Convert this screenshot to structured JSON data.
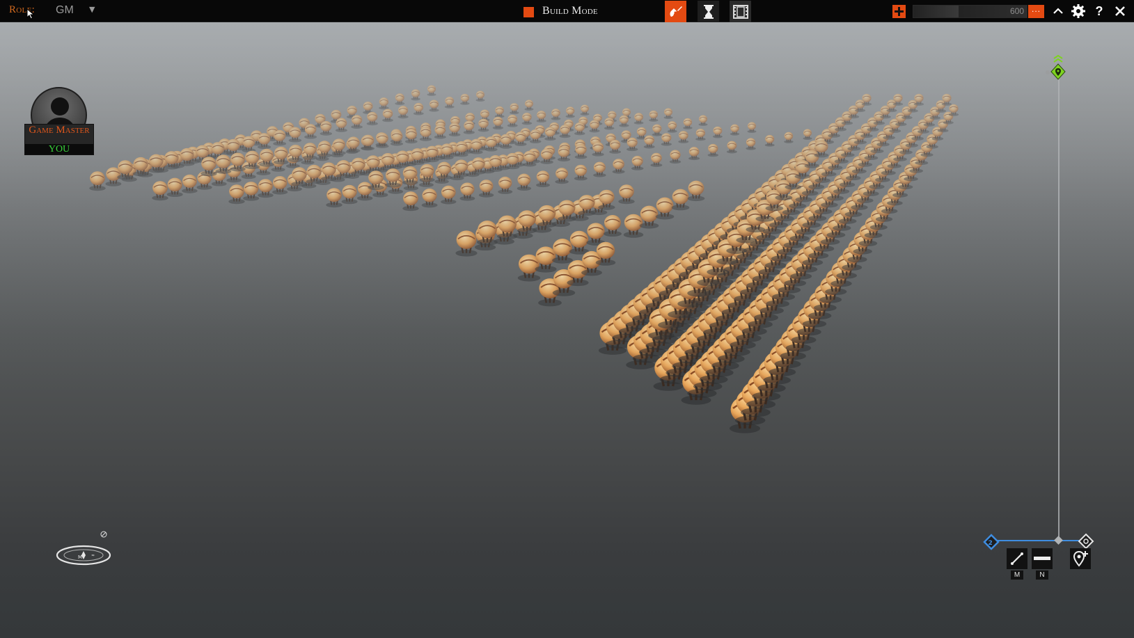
{
  "topbar": {
    "role_label": "Role:",
    "role_value": "GM",
    "mode_label": "Build Mode",
    "mode_color": "#e34a12",
    "tools": [
      {
        "name": "build-tool",
        "icon": "paint-brush-icon",
        "active": true
      },
      {
        "name": "time-tool",
        "icon": "hourglass-icon",
        "active": false
      },
      {
        "name": "cinematic-tool",
        "icon": "film-icon",
        "active": false
      }
    ],
    "counter_value": "600",
    "counter_fill": 0.4,
    "more_label": "...",
    "help_label": "?"
  },
  "player": {
    "title": "Game Master",
    "subtitle": "YOU"
  },
  "timeline": {
    "key_m": "M",
    "key_n": "N"
  },
  "colors": {
    "accent": "#e34a12",
    "timeline": "#3f8de0",
    "camera_marker": "#7ed321",
    "you_label": "#38d33a"
  }
}
